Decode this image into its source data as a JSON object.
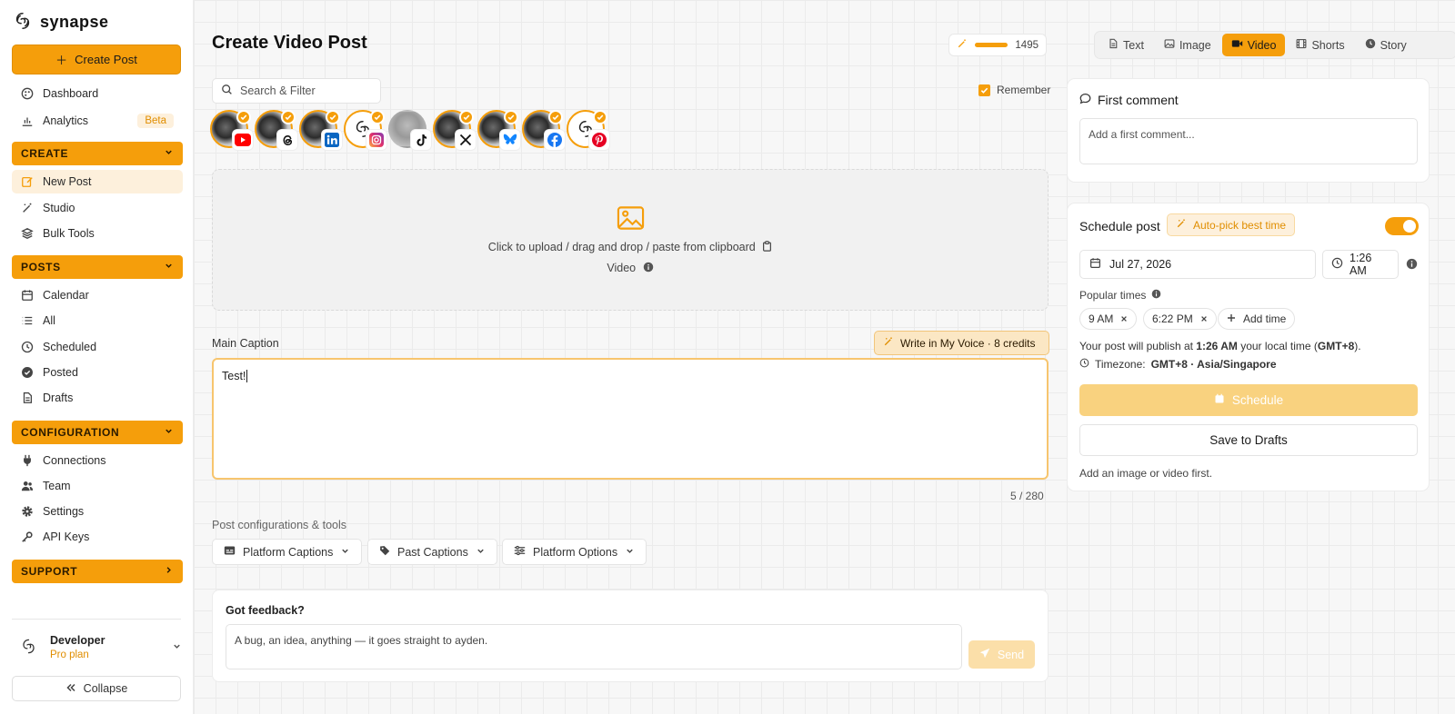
{
  "brand": {
    "name": "synapse"
  },
  "sidebar": {
    "create_post_label": "Create Post",
    "dashboard": "Dashboard",
    "analytics": "Analytics",
    "analytics_badge": "Beta",
    "create_section": "CREATE",
    "new_post": "New Post",
    "studio": "Studio",
    "bulk_tools": "Bulk Tools",
    "posts_section": "POSTS",
    "calendar": "Calendar",
    "all": "All",
    "scheduled": "Scheduled",
    "posted": "Posted",
    "drafts": "Drafts",
    "config_section": "CONFIGURATION",
    "connections": "Connections",
    "team": "Team",
    "settings": "Settings",
    "api_keys": "API Keys",
    "support_section": "SUPPORT",
    "user_name": "Developer",
    "user_plan": "Pro plan",
    "collapse": "Collapse"
  },
  "header": {
    "title": "Create Video Post",
    "credits": "1495",
    "tabs": [
      "Text",
      "Image",
      "Video",
      "Shorts",
      "Story"
    ],
    "active_tab": "Video"
  },
  "composer": {
    "search_placeholder": "Search & Filter",
    "remember_label": "Remember",
    "remember_checked": true,
    "accounts": [
      {
        "platform": "youtube",
        "selected": true
      },
      {
        "platform": "threads",
        "selected": true
      },
      {
        "platform": "linkedin",
        "selected": true
      },
      {
        "platform": "instagram",
        "selected": true
      },
      {
        "platform": "tiktok",
        "selected": false
      },
      {
        "platform": "x",
        "selected": true
      },
      {
        "platform": "bluesky",
        "selected": true
      },
      {
        "platform": "facebook",
        "selected": true
      },
      {
        "platform": "pinterest",
        "selected": true
      }
    ],
    "upload_text": "Click to upload / drag and drop / paste from clipboard",
    "upload_type": "Video",
    "caption_label": "Main Caption",
    "voice_button": "Write in My Voice · 8 credits",
    "caption_value": "Test!",
    "char_count": "5 / 280",
    "tools_label": "Post configurations & tools",
    "tools": [
      "Platform Captions",
      "Past Captions",
      "Platform Options"
    ],
    "feedback_title": "Got feedback?",
    "feedback_placeholder": "A bug, an idea, anything — it goes straight to ayden.",
    "feedback_send": "Send"
  },
  "first_comment": {
    "title": "First comment",
    "placeholder": "Add a first comment..."
  },
  "schedule": {
    "title": "Schedule post",
    "auto_pick": "Auto-pick best time",
    "enabled": true,
    "date": "Jul 27, 2026",
    "time": "1:26 AM",
    "popular_label": "Popular times",
    "popular_times": [
      "9 AM",
      "6:22 PM"
    ],
    "add_time": "Add time",
    "publish_prefix": "Your post will publish at ",
    "publish_time": "1:26 AM",
    "publish_mid": " your local time (",
    "publish_tz": "GMT+8",
    "publish_suffix": ").",
    "timezone_label": "Timezone:",
    "timezone_value": "GMT+8 · Asia/Singapore",
    "schedule_button": "Schedule",
    "drafts_button": "Save to Drafts",
    "media_note": "Add an image or video first."
  },
  "colors": {
    "accent": "#f59e0b",
    "accent_soft": "#fdf0dc"
  }
}
